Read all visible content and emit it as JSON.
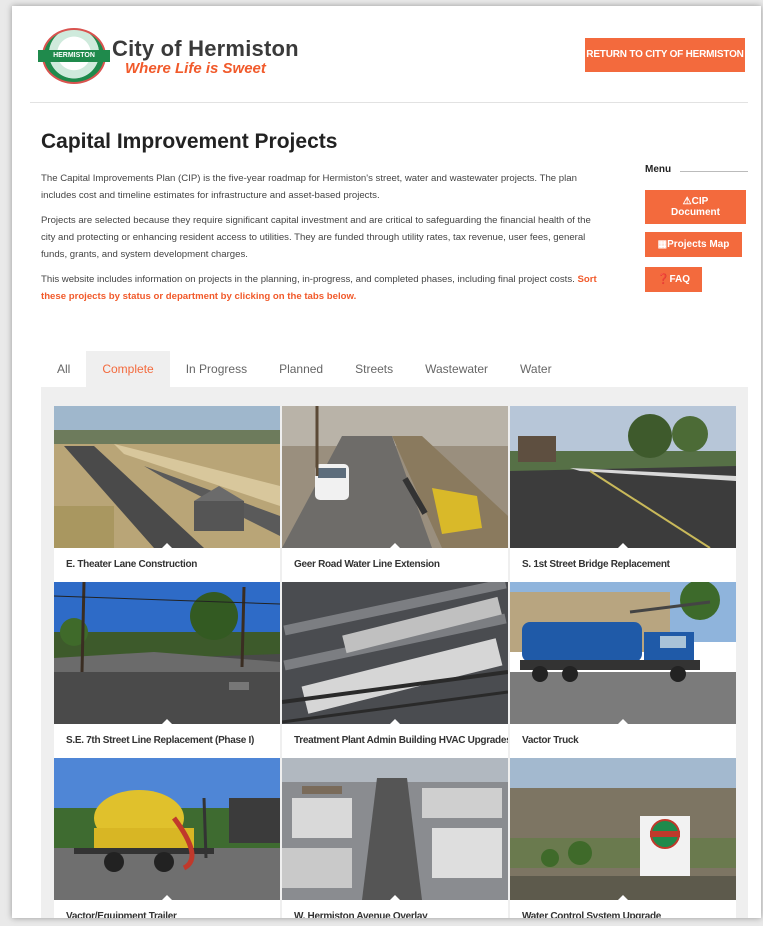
{
  "header": {
    "logo_band": "HERMISTON",
    "logo_title": "City of Hermiston",
    "logo_tagline": "Where Life is Sweet",
    "return_button": "RETURN TO CITY OF HERMISTON"
  },
  "page_title": "Capital Improvement Projects",
  "intro": {
    "p1": "The Capital Improvements Plan (CIP) is the five-year roadmap for Hermiston's street, water and wastewater projects. The plan includes cost and timeline estimates for infrastructure and asset-based projects.",
    "p2": "Projects are selected because they require significant capital investment and are critical to safeguarding the financial health of the city and protecting or enhancing resident access to utilities. They are funded through utility rates, tax revenue, user fees, general funds, grants, and system development charges.",
    "p3": "This website includes information on projects in the planning, in-progress, and completed phases, including final project costs.",
    "p3_highlight": "Sort these projects by status or department by clicking on the tabs below."
  },
  "menu": {
    "title": "Menu",
    "cip_line1": "CIP",
    "cip_line2": "Document",
    "projects_map": "Projects Map",
    "faq": "FAQ"
  },
  "tabs": [
    {
      "label": "All"
    },
    {
      "label": "Complete"
    },
    {
      "label": "In Progress"
    },
    {
      "label": "Planned"
    },
    {
      "label": "Streets"
    },
    {
      "label": "Wastewater"
    },
    {
      "label": "Water"
    }
  ],
  "active_tab": "Complete",
  "projects": [
    {
      "title": "E. Theater Lane Construction"
    },
    {
      "title": "Geer Road Water Line Extension"
    },
    {
      "title": "S. 1st Street Bridge Replacement"
    },
    {
      "title": "S.E. 7th Street Line Replacement (Phase I)"
    },
    {
      "title": "Treatment Plant Admin Building HVAC Upgrades"
    },
    {
      "title": "Vactor Truck"
    },
    {
      "title": "Vactor/Equipment Trailer"
    },
    {
      "title": "W. Hermiston Avenue Overlay"
    },
    {
      "title": "Water Control System Upgrade"
    }
  ],
  "colors": {
    "accent": "#f36a3d",
    "tagline": "#f15a2b",
    "logo_green": "#1f8a4c"
  },
  "icons": {
    "cip": "warning-triangle-icon",
    "map": "map-icon",
    "faq": "question-circle-icon"
  }
}
